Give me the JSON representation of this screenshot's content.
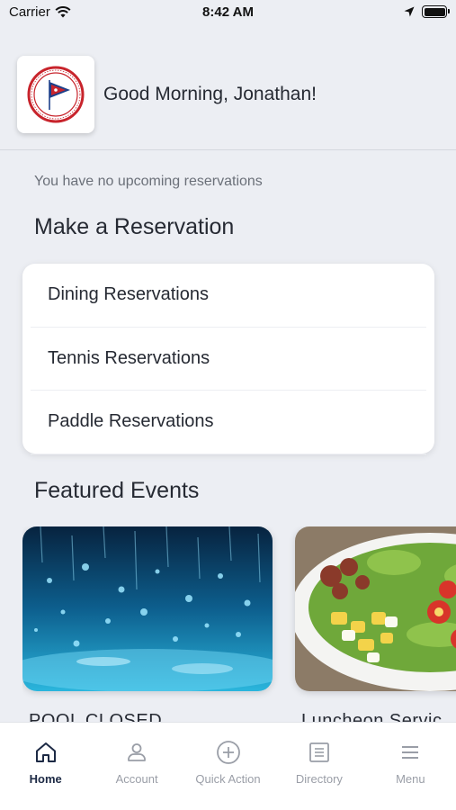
{
  "status": {
    "carrier": "Carrier",
    "time": "8:42 AM"
  },
  "header": {
    "greeting": "Good Morning, Jonathan!"
  },
  "reservations": {
    "empty_text": "You have no upcoming reservations",
    "title": "Make a Reservation",
    "items": [
      {
        "label": "Dining Reservations"
      },
      {
        "label": "Tennis Reservations"
      },
      {
        "label": "Paddle Reservations"
      }
    ]
  },
  "events": {
    "title": "Featured Events",
    "items": [
      {
        "title": "POOL CLOSED",
        "image": "rain-drops-on-water"
      },
      {
        "title": "Luncheon Servic",
        "image": "cobb-salad-bowl"
      }
    ]
  },
  "tabbar": {
    "items": [
      {
        "label": "Home",
        "icon": "home-icon",
        "active": true
      },
      {
        "label": "Account",
        "icon": "account-icon"
      },
      {
        "label": "Quick Action",
        "icon": "plus-circle-icon"
      },
      {
        "label": "Directory",
        "icon": "directory-icon"
      },
      {
        "label": "Menu",
        "icon": "menu-icon"
      }
    ]
  },
  "colors": {
    "background": "#eceef3",
    "text": "#262a33",
    "tab_active": "#1d2a45",
    "tab_inactive": "#9a9ea7"
  }
}
